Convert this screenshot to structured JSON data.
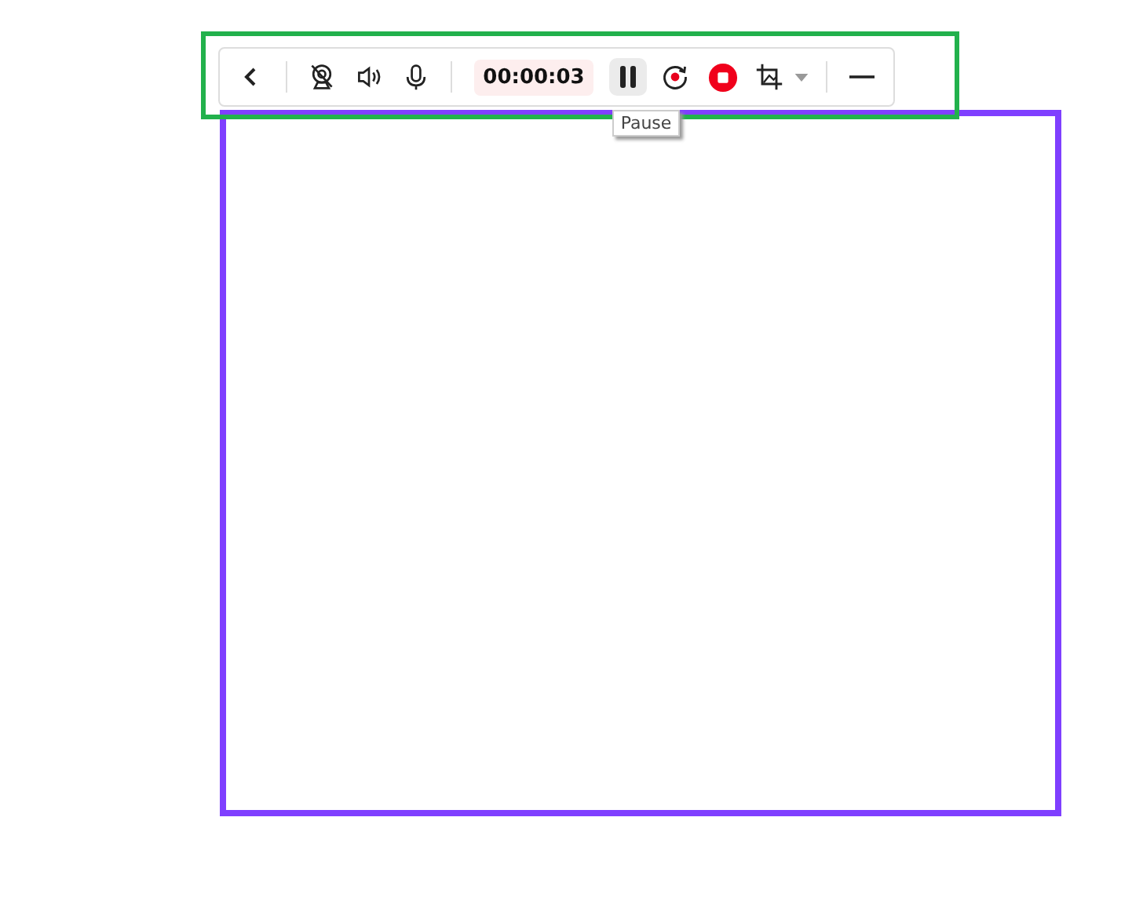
{
  "toolbar": {
    "items": [
      {
        "kind": "back",
        "hovered": false
      },
      {
        "kind": "divider"
      },
      {
        "kind": "webcam",
        "hovered": false
      },
      {
        "kind": "speaker",
        "hovered": false
      },
      {
        "kind": "mic",
        "hovered": false
      },
      {
        "kind": "divider"
      },
      {
        "kind": "timer",
        "text": "00:00:03"
      },
      {
        "kind": "pause",
        "hovered": true,
        "tooltip": "Pause"
      },
      {
        "kind": "restart",
        "hovered": false
      },
      {
        "kind": "stop",
        "hovered": false
      },
      {
        "kind": "crop",
        "hovered": false
      },
      {
        "kind": "dropdown",
        "hovered": false
      },
      {
        "kind": "divider"
      },
      {
        "kind": "minimize",
        "hovered": false
      }
    ]
  }
}
